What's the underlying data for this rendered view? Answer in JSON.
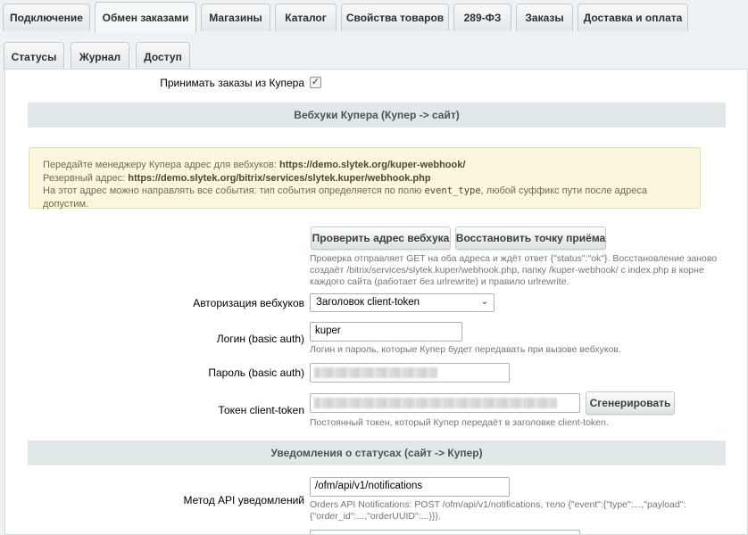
{
  "tabs": {
    "row1": [
      "Подключение",
      "Обмен заказами",
      "Магазины",
      "Каталог",
      "Свойства товаров",
      "289-ФЗ",
      "Заказы",
      "Доставка и оплата"
    ],
    "row2": [
      "Статусы",
      "Журнал",
      "Доступ"
    ],
    "active_row1": "Обмен заказами"
  },
  "accept_orders": {
    "label": "Принимать заказы из Купера",
    "checked": true
  },
  "webhooks_section": {
    "title": "Вебхуки Купера (Купер -> сайт)",
    "note": {
      "line1_prefix": "Передайте менеджеру Купера адрес для вебхуков: ",
      "line1_url": "https://demo.slytek.org/kuper-webhook/",
      "line2_prefix": "Резервный адрес: ",
      "line2_url": "https://demo.slytek.org/bitrix/services/slytek.kuper/webhook.php",
      "line3_prefix": "На этот адрес можно направлять все события: тип события определяется по полю ",
      "line3_code": "event_type",
      "line3_suffix": ", любой суффикс пути после адреса допустим."
    },
    "check_button": "Проверить адрес вебхука",
    "restore_button": "Восстановить точку приёма",
    "check_hint": "Проверка отправляет GET на оба адреса и ждёт ответ {\"status\":\"ok\"}. Восстановление заново создаёт /bitrix/services/slytek.kuper/webhook.php, папку /kuper-webhook/ с index.php в корне каждого сайта (работает без urlrewrite) и правило urlrewrite.",
    "auth_label": "Авторизация вебхуков",
    "auth_value": "Заголовок client-token",
    "login_label": "Логин (basic auth)",
    "login_value": "kuper",
    "login_hint": "Логин и пароль, которые Купер будет передавать при вызове вебхуков.",
    "password_label": "Пароль (basic auth)",
    "token_label": "Токен client-token",
    "generate_button": "Сгенерировать",
    "token_hint": "Постоянный токен, который Купер передаёт в заголовке client-token."
  },
  "status_section": {
    "title": "Уведомления о статусах (сайт -> Купер)",
    "method_label": "Метод API уведомлений",
    "method_value": "/ofm/api/v1/notifications",
    "method_hint": "Orders API Notifications: POST /ofm/api/v1/notifications, тело {\"event\":{\"type\":...,\"payload\":{\"order_id\":...,\"orderUUID\":...}}}."
  },
  "icons": {
    "checkbox": "checkmark-icon",
    "select": "chevron-down-icon"
  }
}
